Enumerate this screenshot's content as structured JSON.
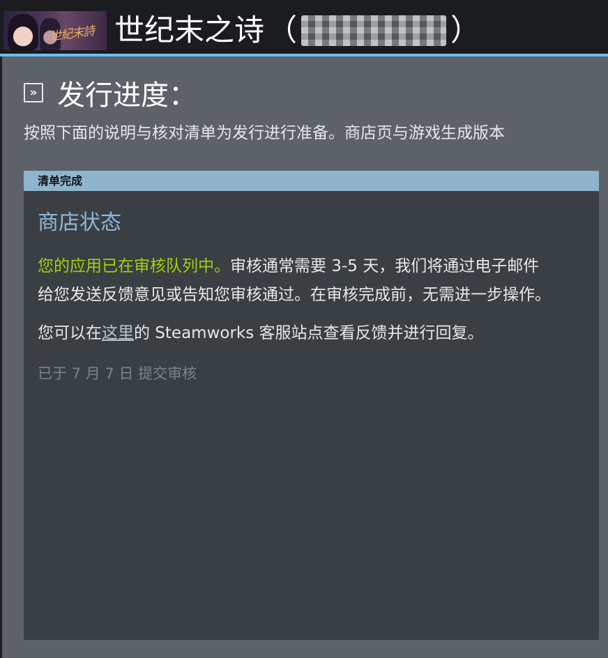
{
  "header": {
    "game_title": "世纪末之诗",
    "paren_open": "（",
    "paren_close": "）",
    "app_id_redacted": ""
  },
  "capsule": {
    "logo_text": "世紀末詩"
  },
  "section": {
    "title": "发行进度："
  },
  "intro": "按照下面的说明与核对清单为发行进行准备。商店页与游戏生成版本",
  "card": {
    "bar_label": "清单完成",
    "heading": "商店状态",
    "status_highlight": "您的应用已在审核队列中。",
    "status_rest": "审核通常需要 3-5 天，我们将通过电子邮件给您发送反馈意见或告知您审核通过。在审核完成前，无需进一步操作。",
    "feedback_prefix": "您可以在",
    "feedback_link": "这里",
    "feedback_suffix": "的 Steamworks 客服站点查看反馈并进行回复。",
    "submitted": "已于 7 月 7 日 提交审核"
  },
  "colors": {
    "accent_blue": "#66c0f4",
    "status_green": "#a4d007",
    "bar_blue": "#8fb4ce",
    "heading_blue": "#8fb7d6"
  },
  "icons": {
    "section": "chevron-double-right-icon"
  }
}
